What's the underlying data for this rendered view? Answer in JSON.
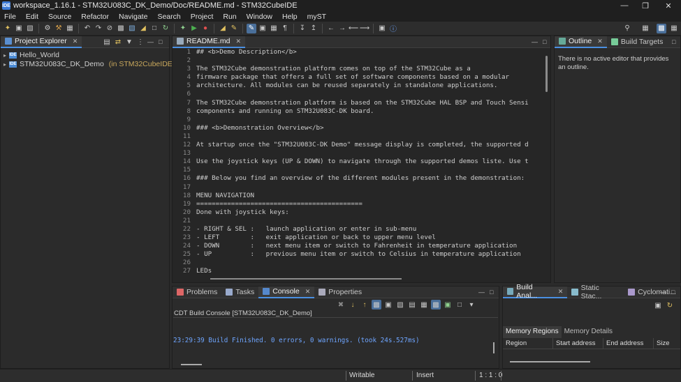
{
  "window": {
    "title": "workspace_1.16.1 - STM32U083C_DK_Demo/Doc/README.md - STM32CubeIDE",
    "app_icon": "IDE"
  },
  "menu": [
    "File",
    "Edit",
    "Source",
    "Refactor",
    "Navigate",
    "Search",
    "Project",
    "Run",
    "Window",
    "Help",
    "myST"
  ],
  "project_explorer": {
    "tab_label": "Project Explorer",
    "items": [
      {
        "name": "Hello_World",
        "suffix": ""
      },
      {
        "name": "STM32U083C_DK_Demo",
        "suffix": " (in STM32CubeIDE)"
      }
    ]
  },
  "editor": {
    "tab_label": "README.md",
    "lines": [
      {
        "n": "1",
        "t": "## <b>Demo Description</b>"
      },
      {
        "n": "2",
        "t": ""
      },
      {
        "n": "3",
        "t": "The STM32Cube demonstration platform comes on top of the STM32Cube as a"
      },
      {
        "n": "4",
        "t": "firmware package that offers a full set of software components based on a modular"
      },
      {
        "n": "5",
        "t": "architecture. All modules can be reused separately in standalone applications."
      },
      {
        "n": "6",
        "t": ""
      },
      {
        "n": "7",
        "t": "The STM32Cube demonstration platform is based on the STM32Cube HAL BSP and Touch Sensi"
      },
      {
        "n": "8",
        "t": "components and running on STM32U083C-DK board."
      },
      {
        "n": "9",
        "t": ""
      },
      {
        "n": "10",
        "t": "### <b>Demonstration Overview</b>"
      },
      {
        "n": "11",
        "t": ""
      },
      {
        "n": "12",
        "t": "At startup once the \"STM32U083C-DK Demo\" message display is completed, the supported d"
      },
      {
        "n": "13",
        "t": ""
      },
      {
        "n": "14",
        "t": "Use the joystick keys (UP & DOWN) to navigate through the supported demos liste. Use t"
      },
      {
        "n": "15",
        "t": ""
      },
      {
        "n": "16",
        "t": "### Below you find an overview of the different modules present in the demonstration:"
      },
      {
        "n": "17",
        "t": ""
      },
      {
        "n": "18",
        "t": "MENU NAVIGATION"
      },
      {
        "n": "19",
        "t": "==========================================="
      },
      {
        "n": "20",
        "t": "Done with joystick keys:"
      },
      {
        "n": "21",
        "t": ""
      },
      {
        "n": "22",
        "t": "- RIGHT & SEL :   launch application or enter in sub-menu"
      },
      {
        "n": "23",
        "t": "- LEFT        :   exit application or back to upper menu level"
      },
      {
        "n": "24",
        "t": "- DOWN        :   next menu item or switch to Fahrenheit in temperature application"
      },
      {
        "n": "25",
        "t": "- UP          :   previous menu item or switch to Celsius in temperature application"
      },
      {
        "n": "26",
        "t": ""
      },
      {
        "n": "27",
        "t": "LEDs"
      }
    ]
  },
  "outline": {
    "tab_label": "Outline",
    "tab2_label": "Build Targets",
    "message": "There is no active editor that provides an outline."
  },
  "bottom": {
    "tabs": [
      "Problems",
      "Tasks",
      "Console",
      "Properties"
    ],
    "console_title": "CDT Build Console [STM32U083C_DK_Demo]",
    "console_output": "23:29:39 Build Finished. 0 errors, 0 warnings. (took 24s.527ms)"
  },
  "build_analyzer": {
    "tabs": [
      "Build Anal...",
      "Static Stac...",
      "Cyclomati..."
    ],
    "subtabs": [
      "Memory Regions",
      "Memory Details"
    ],
    "columns": [
      "Region",
      "Start address",
      "End address",
      "Size"
    ]
  },
  "status": {
    "writable": "Writable",
    "insert": "Insert",
    "position": "1 : 1 : 0"
  }
}
